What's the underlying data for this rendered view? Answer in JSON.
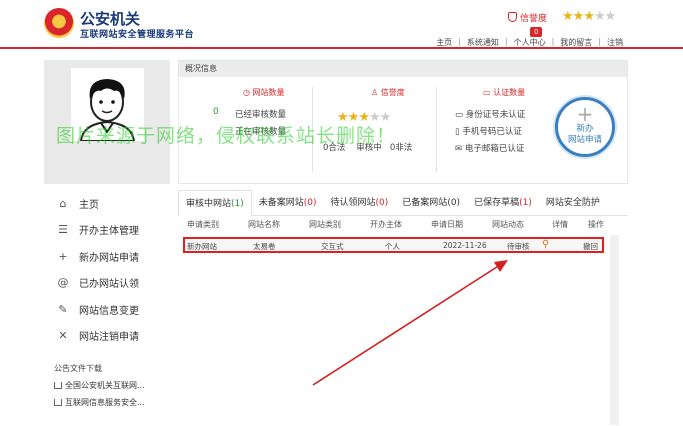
{
  "header": {
    "title": "公安机关",
    "subtitle": "互联网站安全管理服务平台",
    "credit_label": "信誉度",
    "credit_badge": "0",
    "nav": [
      "主页",
      "系统通知",
      "个人中心",
      "我的留言",
      "注销"
    ]
  },
  "sidebar": {
    "items": [
      {
        "icon": "home-icon",
        "label": "主页"
      },
      {
        "icon": "list-icon",
        "label": "开办主体管理"
      },
      {
        "icon": "plus-icon",
        "label": "新办网站申请"
      },
      {
        "icon": "at-icon",
        "label": "已办网站认领"
      },
      {
        "icon": "edit-icon",
        "label": "网站信息变更"
      },
      {
        "icon": "close-icon",
        "label": "网站注销申请"
      }
    ]
  },
  "notice": {
    "title": "公告文件下载",
    "items": [
      "全国公安机关互联网...",
      "互联网信息服务安全..."
    ]
  },
  "overview": {
    "title": "概况信息",
    "site_count": {
      "title": "网站数量",
      "reviewed_count": "0",
      "reviewed_label": "已经审核数量",
      "pending_label": "正在审核数量"
    },
    "credit": {
      "title": "信誉度",
      "stars_filled": 3,
      "stars_total": 5,
      "stats_text": "0合法    审核中   0非法"
    },
    "cert": {
      "title": "认证数量",
      "items": [
        "身份证号未认证",
        "手机号码已认证",
        "电子邮箱已认证"
      ]
    },
    "new_site_button": {
      "line1": "新办",
      "line2": "网站申请"
    }
  },
  "tabs": [
    {
      "label": "审核中网站",
      "count": "(1)",
      "active": true
    },
    {
      "label": "未备案网站",
      "count": "(0)",
      "active": false
    },
    {
      "label": "待认领网站",
      "count": "(0)",
      "active": false
    },
    {
      "label": "已备案网站",
      "count": "(0)",
      "active": false
    },
    {
      "label": "已保存草稿",
      "count": "(1)",
      "active": false
    },
    {
      "label": "网站安全防护",
      "count": "",
      "active": false
    }
  ],
  "table": {
    "headers": [
      "申请类别",
      "网站名称",
      "网站类别",
      "开办主体",
      "申请日期",
      "网站动态",
      "详情",
      "操作"
    ],
    "rows": [
      {
        "type": "新办网站",
        "name": "太易卷",
        "category": "交互式",
        "subject": "个人",
        "date": "2022-11-26",
        "status": "待审核",
        "action": "撤回"
      }
    ]
  },
  "watermark": "图片来源于网络，侵权联系站长删除！",
  "colors": {
    "brand_red": "#d9252b",
    "brand_blue": "#1a3a7a",
    "star_gold": "#e8b418",
    "count_green": "#2a9a3a",
    "link_blue": "#3a7fc1"
  }
}
